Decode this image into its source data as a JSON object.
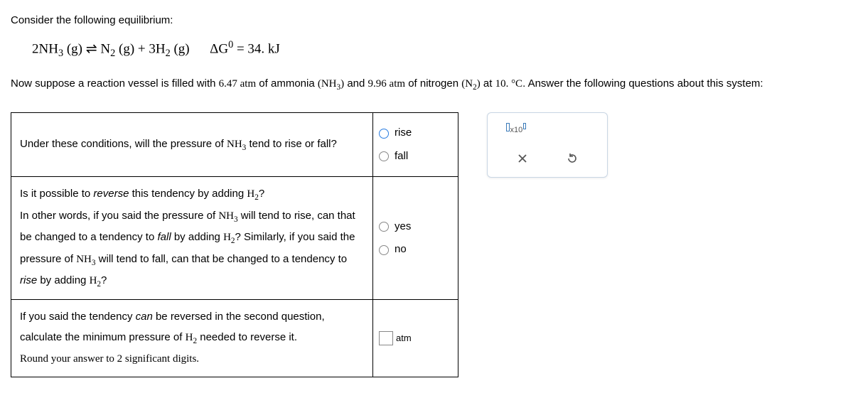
{
  "chevron_icon": "⌄",
  "intro": "Consider the following equilibrium:",
  "equation": {
    "lhs": "2NH",
    "lhs_sub": "3",
    "lhs_state": " (g) ⇌ N",
    "n2_sub": "2",
    "mid": " (g) + 3H",
    "h2_sub": "2",
    "rhs_state": " (g)",
    "dg_label": "ΔG",
    "dg_sup": "0",
    "dg_val": " = 34. kJ"
  },
  "prompt": {
    "p1a": "Now suppose a reaction vessel is filled with ",
    "p1_val1": "6.47 atm",
    "p1b": " of ammonia ",
    "p1_f1": "(NH",
    "p1_f1_sub": "3",
    "p1_f1_close": ")",
    "p1c": " and ",
    "p1_val2": "9.96 atm",
    "p1d": " of nitrogen ",
    "p1_f2": "(N",
    "p1_f2_sub": "2",
    "p1_f2_close": ")",
    "p1e": " at ",
    "p1_temp": "10. °C",
    "p1f": ". Answer the following questions about this system:"
  },
  "q1": {
    "text_a": "Under these conditions, will the pressure of ",
    "chem": "NH",
    "chem_sub": "3",
    "text_b": " tend to rise or fall?",
    "opt1": "rise",
    "opt2": "fall"
  },
  "q2": {
    "l1a": "Is it possible to ",
    "l1_em": "reverse",
    "l1b": " this tendency by adding ",
    "l1_chem": "H",
    "l1_sub": "2",
    "l1c": "?",
    "l2a": "In other words, if you said the pressure of ",
    "l2_chem": "NH",
    "l2_sub": "3",
    "l2b": " will tend to rise, can that be changed to a tendency to ",
    "l2_em": "fall",
    "l2c": " by adding ",
    "l2_chem2": "H",
    "l2_sub2": "2",
    "l2d": "? Similarly, if you said the pressure of ",
    "l2_chem3": "NH",
    "l2_sub3": "3",
    "l2e": " will tend to fall, can that be changed to a tendency to ",
    "l2_em2": "rise",
    "l2f": " by adding ",
    "l2_chem4": "H",
    "l2_sub4": "2",
    "l2g": "?",
    "opt1": "yes",
    "opt2": "no"
  },
  "q3": {
    "l1a": "If you said the tendency ",
    "l1_em": "can",
    "l1b": " be reversed in the second question, calculate the minimum pressure of ",
    "l1_chem": "H",
    "l1_sub": "2",
    "l1c": " needed to reverse it.",
    "l2": "Round your answer to 2 significant digits.",
    "unit": "atm"
  },
  "tool": {
    "x10": "x10"
  }
}
